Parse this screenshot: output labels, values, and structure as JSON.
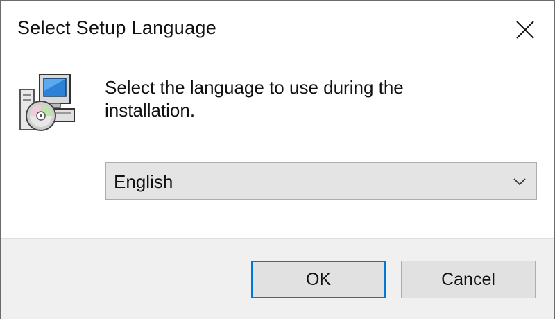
{
  "window": {
    "title": "Select Setup Language",
    "close_icon": "close-icon"
  },
  "content": {
    "icon": "setup-computer-cd-icon",
    "prompt": "Select the language to use during the installation."
  },
  "language_select": {
    "selected": "English",
    "arrow_icon": "chevron-down-icon"
  },
  "buttons": {
    "ok_label": "OK",
    "cancel_label": "Cancel"
  },
  "colors": {
    "default_button_border": "#0078d7",
    "footer_background": "#f0f0f0",
    "select_background": "#e4e4e4"
  }
}
